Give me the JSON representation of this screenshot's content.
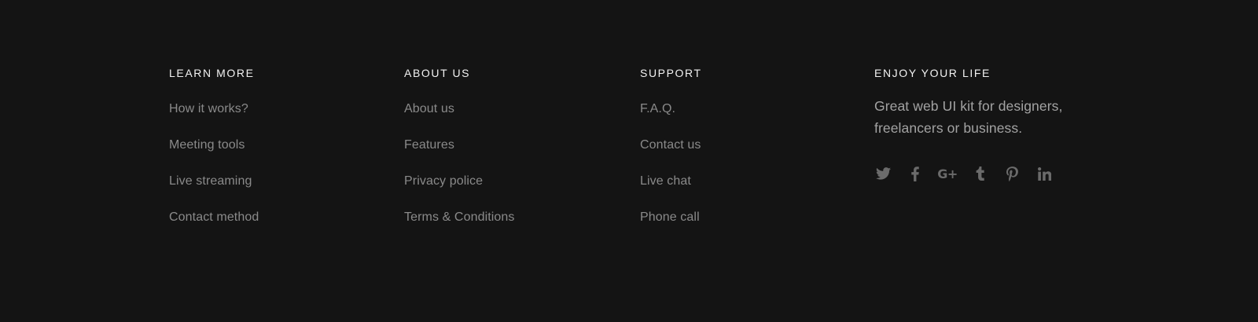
{
  "learn_more": {
    "heading": "LEARN MORE",
    "links": [
      "How it works?",
      "Meeting tools",
      "Live streaming",
      "Contact method"
    ]
  },
  "about_us": {
    "heading": "ABOUT US",
    "links": [
      "About us",
      "Features",
      "Privacy police",
      "Terms & Conditions"
    ]
  },
  "support": {
    "heading": "SUPPORT",
    "links": [
      "F.A.Q.",
      "Contact us",
      "Live chat",
      "Phone call"
    ]
  },
  "enjoy": {
    "heading": "ENJOY YOUR LIFE",
    "tagline_line1": "Great web UI kit for designers,",
    "tagline_line2": "freelancers or business.",
    "social_icons": [
      "twitter-icon",
      "facebook-icon",
      "google-plus-icon",
      "tumblr-icon",
      "pinterest-icon",
      "linkedin-icon"
    ],
    "google_plus_glyph": "G+"
  },
  "colors": {
    "background": "#141414",
    "heading": "#f2f2f2",
    "link": "#8a8a8a",
    "icon": "#6b6b6b"
  }
}
